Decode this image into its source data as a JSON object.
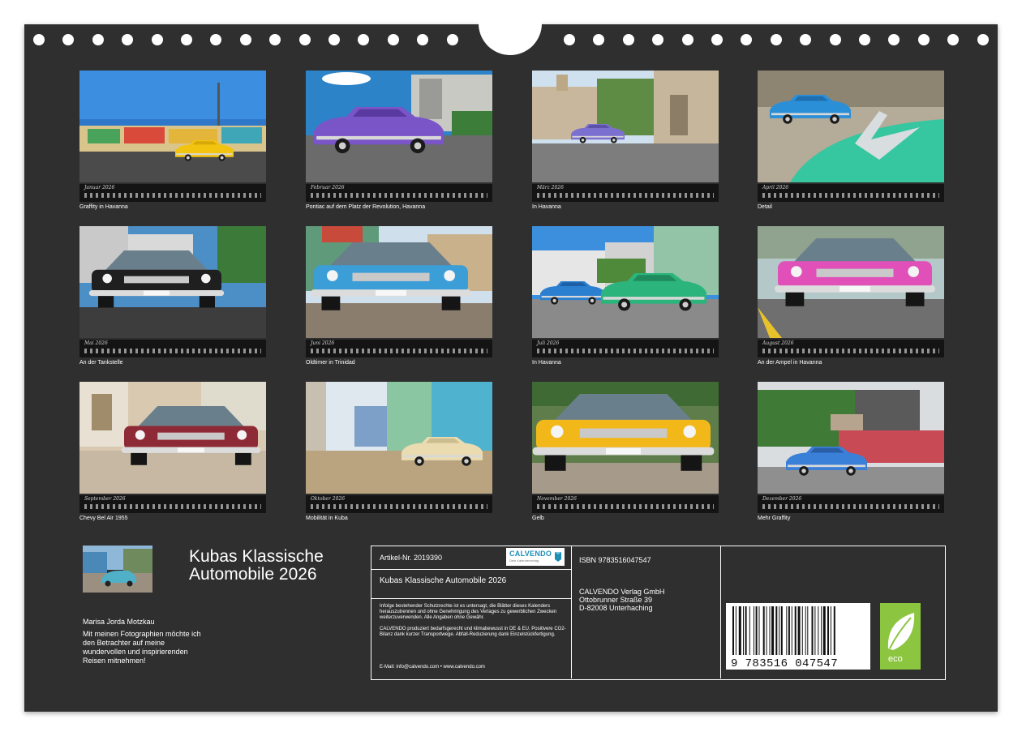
{
  "months": [
    {
      "name": "Januar 2026",
      "caption": "Graffity in Havanna",
      "scene": "graffiti"
    },
    {
      "name": "Februar 2026",
      "caption": "Pontiac auf dem Platz der Revolution, Havanna",
      "scene": "purple"
    },
    {
      "name": "März 2026",
      "caption": "In Havanna",
      "scene": "street"
    },
    {
      "name": "April 2026",
      "caption": "Detail",
      "scene": "detail"
    },
    {
      "name": "Mai 2026",
      "caption": "An der Tankstelle",
      "scene": "black"
    },
    {
      "name": "Juni 2026",
      "caption": "Oldtimer in Trinidad",
      "scene": "blue"
    },
    {
      "name": "Juli 2026",
      "caption": "In Havanna",
      "scene": "green"
    },
    {
      "name": "August 2026",
      "caption": "An der Ampel in Havanna",
      "scene": "pink"
    },
    {
      "name": "September 2026",
      "caption": "Chevy Bel Air 1955",
      "scene": "maroon"
    },
    {
      "name": "Oktober 2026",
      "caption": "Mobilität in Kuba",
      "scene": "cream"
    },
    {
      "name": "November 2026",
      "caption": "Gelb",
      "scene": "yellow"
    },
    {
      "name": "Dezember 2026",
      "caption": "Mehr Graffity",
      "scene": "train"
    }
  ],
  "calendar": {
    "title_line1": "Kubas Klassische",
    "title_line2": "Automobile 2026"
  },
  "author": {
    "name": "Marisa Jorda Motzkau",
    "description": "Mit meinen Fotographien möchte ich den Betrachter auf meine wundervollen und inspirierenden Reisen mitnehmen!"
  },
  "info": {
    "article": "Artikel-Nr. 2019390",
    "logo_name": "CALVENDO",
    "logo_tagline": "Dein Kalenderverlag",
    "title": "Kubas Klassische Automobile 2026",
    "legal_1": "Infolge bestehender Schutzrechte ist es untersagt, die Blätter dieses Kalenders herauszutrennen und ohne Genehmigung des Verlages zu gewerblichen Zwecken weiterzuverwenden. Alle Angaben ohne Gewähr.",
    "legal_2": "CALVENDO produziert bedarfsgerecht und klimabewusst in DE & EU. Positivere CO2-Bilanz dank kurzer Transportwege. Abfall-Reduzierung dank Einzelstückfertigung.",
    "contact": "E-Mail: info@calvendo.com • www.calvendo.com",
    "isbn": "ISBN 9783516047547",
    "publisher": "CALVENDO Verlag GmbH",
    "street": "Ottobrunner Straße 39",
    "city": "D-82008 Unterhaching",
    "barcode_number": "9 783516 047547",
    "eco_label": "eco"
  },
  "colors": {
    "background": "#2f2f2f",
    "text": "#ffffff",
    "eco_green": "#8cc641",
    "logo_blue": "#1d8fb5"
  }
}
